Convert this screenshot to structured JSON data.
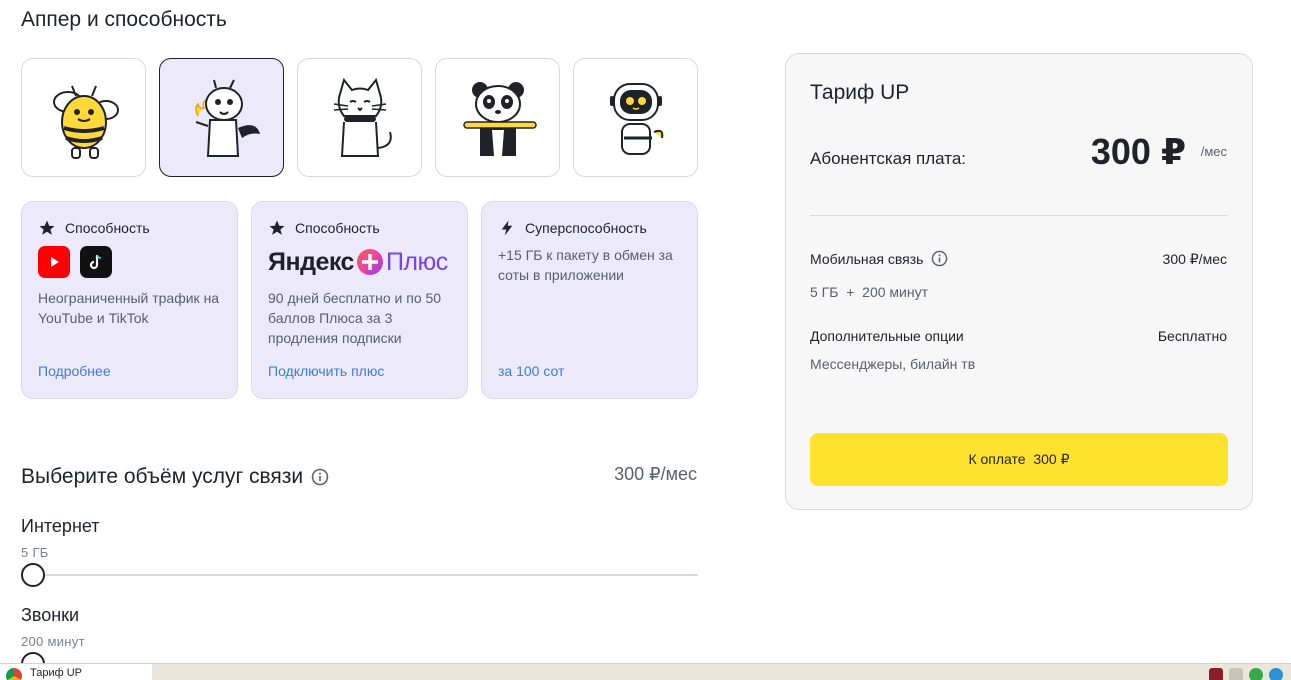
{
  "upper": {
    "title": "Аппер и способность",
    "avatars": [
      {
        "icon": "bee-avatar-icon",
        "selected": false
      },
      {
        "icon": "dragon-avatar-icon",
        "selected": true
      },
      {
        "icon": "cat-avatar-icon",
        "selected": false
      },
      {
        "icon": "panda-avatar-icon",
        "selected": false
      },
      {
        "icon": "robot-avatar-icon",
        "selected": false
      }
    ]
  },
  "abilities": [
    {
      "badge": "Способность",
      "icon": "star-icon",
      "desc": "Неограниченный трафик на YouTube и TikTok",
      "link": "Подробнее"
    },
    {
      "badge": "Способность",
      "icon": "star-icon",
      "brand_left": "Яндекс",
      "brand_right": "Плюс",
      "desc": "90 дней бесплатно и по 50 баллов Плюса за 3 продления подписки",
      "link": "Подключить плюс"
    },
    {
      "badge": "Суперспособность",
      "icon": "lightning-icon",
      "desc": "+15 ГБ к пакету в обмен за соты в приложении",
      "link": "за 100 сот"
    }
  ],
  "volume": {
    "title": "Выберите объём услуг связи",
    "price": "300 ₽/мес",
    "internet": {
      "label": "Интернет",
      "value": "5 ГБ",
      "level": 0
    },
    "calls": {
      "label": "Звонки",
      "value": "200 минут",
      "level": 0
    }
  },
  "tariff": {
    "name": "Тариф UP",
    "fee_label": "Абонентская плата:",
    "fee_value": "300 ₽",
    "fee_unit": "/мес",
    "mobile_label": "Мобильная связь",
    "mobile_price": "300 ₽/мес",
    "mobile_detail": "5 ГБ  +  200 минут",
    "options_label": "Дополнительные опции",
    "options_price": "Бесплатно",
    "options_detail": "Мессенджеры, билайн тв",
    "pay_button": "К оплате  300 ₽"
  },
  "taskbar": {
    "app_label": "Тариф UP"
  },
  "colors": {
    "accent_yellow": "#ffe22e",
    "card_lavender": "#ece9fa",
    "link_blue": "#3b7ed8"
  }
}
